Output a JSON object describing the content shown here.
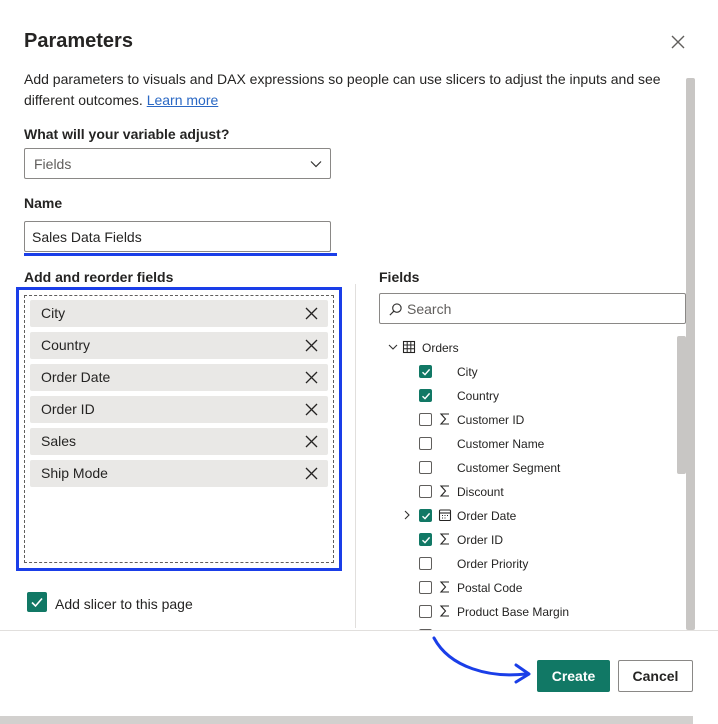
{
  "dialog": {
    "title": "Parameters",
    "description": "Add parameters to visuals and DAX expressions so people can use slicers to adjust the inputs and see different outcomes.",
    "learn_more": "Learn more"
  },
  "variable_adjust": {
    "label": "What will your variable adjust?",
    "selected": "Fields"
  },
  "name": {
    "label": "Name",
    "value": "Sales Data Fields"
  },
  "reorder": {
    "label": "Add and reorder fields",
    "items": [
      "City",
      "Country",
      "Order Date",
      "Order ID",
      "Sales",
      "Ship Mode"
    ]
  },
  "fields": {
    "label": "Fields",
    "search_placeholder": "Search",
    "table": {
      "name": "Orders",
      "expanded": true
    },
    "items": [
      {
        "label": "City",
        "checked": true,
        "icon": "",
        "expandable": false
      },
      {
        "label": "Country",
        "checked": true,
        "icon": "",
        "expandable": false
      },
      {
        "label": "Customer ID",
        "checked": false,
        "icon": "sigma-icon",
        "expandable": false
      },
      {
        "label": "Customer Name",
        "checked": false,
        "icon": "",
        "expandable": false
      },
      {
        "label": "Customer Segment",
        "checked": false,
        "icon": "",
        "expandable": false
      },
      {
        "label": "Discount",
        "checked": false,
        "icon": "sigma-icon",
        "expandable": false
      },
      {
        "label": "Order Date",
        "checked": true,
        "icon": "calendar-icon",
        "expandable": true
      },
      {
        "label": "Order ID",
        "checked": true,
        "icon": "sigma-icon",
        "expandable": false
      },
      {
        "label": "Order Priority",
        "checked": false,
        "icon": "",
        "expandable": false
      },
      {
        "label": "Postal Code",
        "checked": false,
        "icon": "sigma-icon",
        "expandable": false
      },
      {
        "label": "Product Base Margin",
        "checked": false,
        "icon": "sigma-icon",
        "expandable": false
      }
    ]
  },
  "slicer": {
    "label": "Add slicer to this page",
    "checked": true
  },
  "buttons": {
    "create": "Create",
    "cancel": "Cancel"
  },
  "colors": {
    "accent": "#117865",
    "highlight": "#1a3ee8",
    "link": "#2a68c4"
  }
}
